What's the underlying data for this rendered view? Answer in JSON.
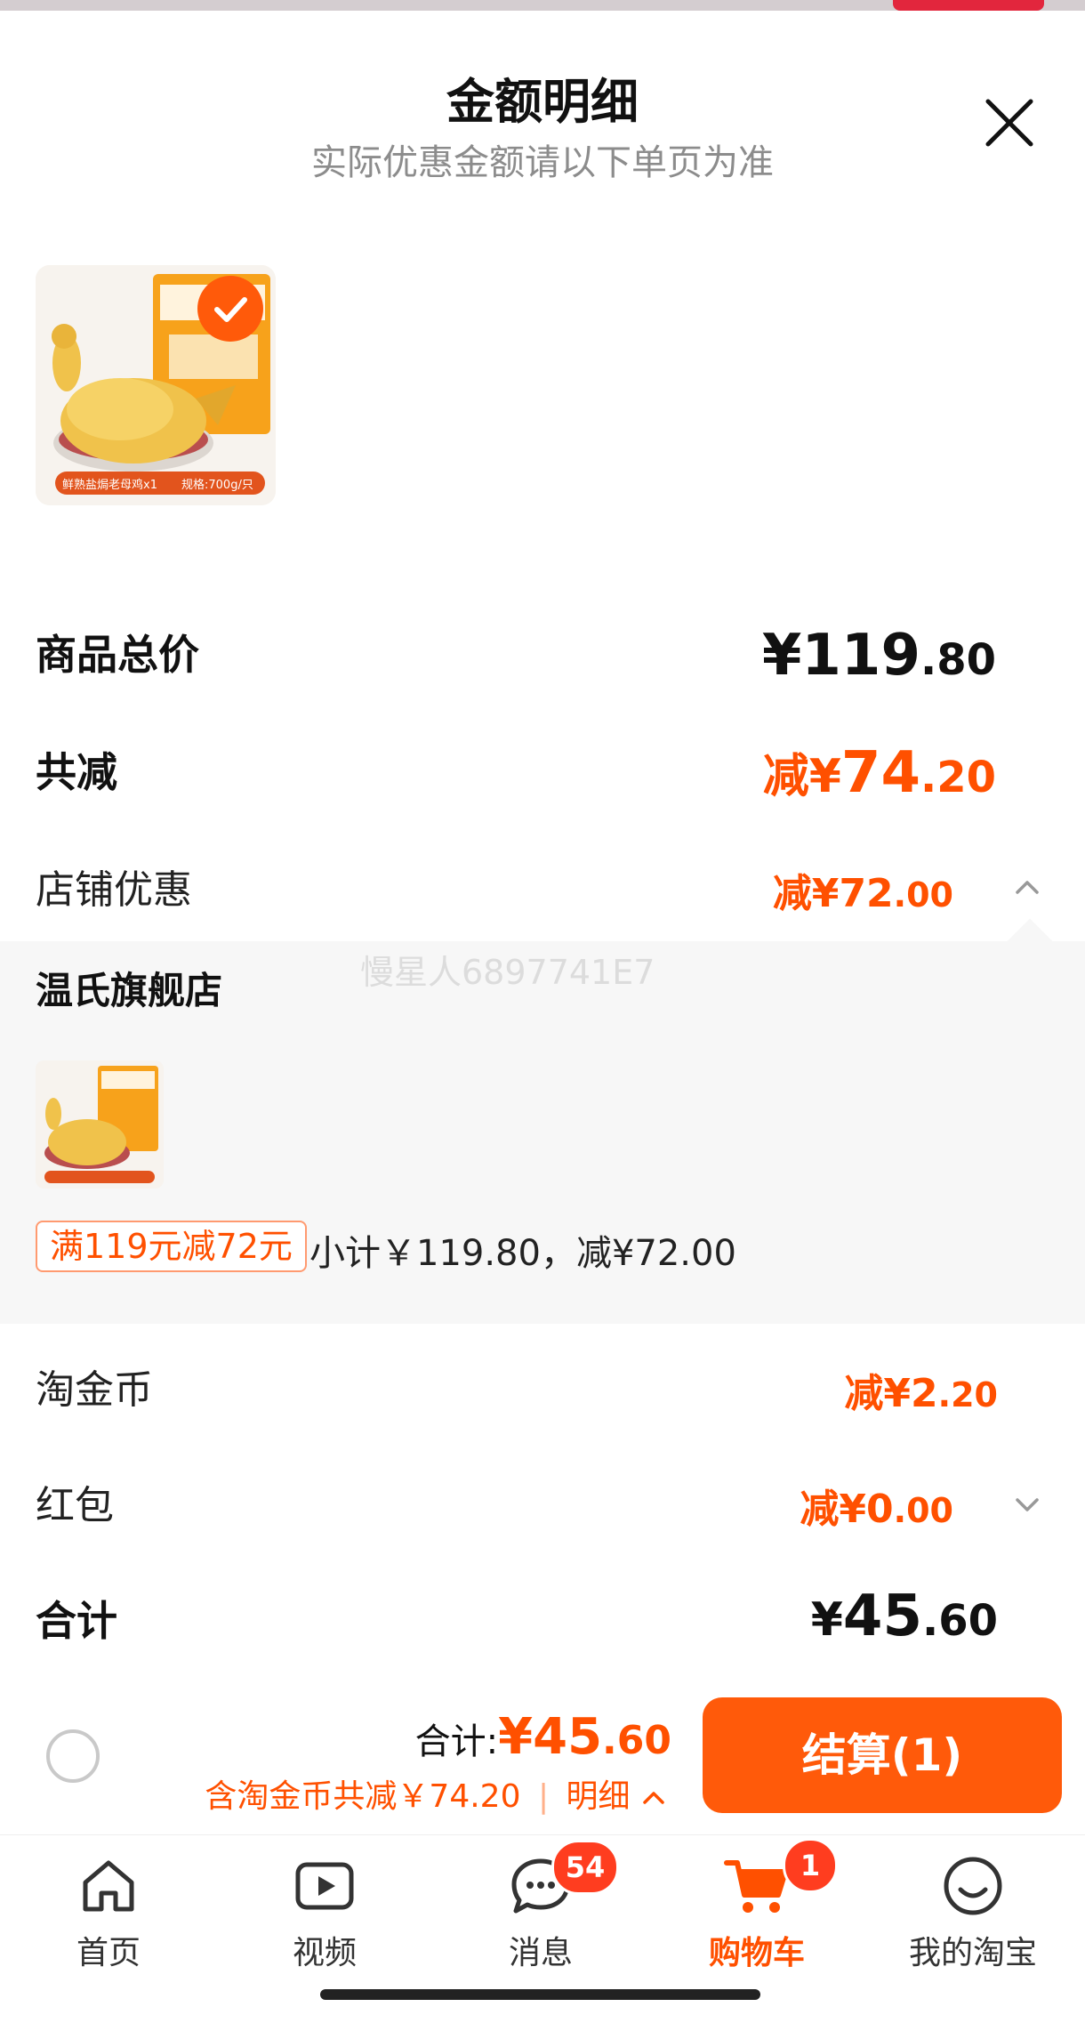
{
  "dialog": {
    "title": "金额明细",
    "subtitle": "实际优惠金额请以下单页为准"
  },
  "summary": {
    "goods_total_label": "商品总价",
    "goods_total_currency": "¥",
    "goods_total_int": "119",
    "goods_total_dec": ".80",
    "total_discount_label": "共减",
    "total_discount_prefix": "减¥",
    "total_discount_int": "74",
    "total_discount_dec": ".20",
    "store_discount_label": "店铺优惠",
    "store_discount_prefix": "减¥",
    "store_discount_int": "72",
    "store_discount_dec": ".00"
  },
  "store_panel": {
    "store_name": "温氏旗舰店",
    "watermark": "慢星人6897741E7",
    "promo_tag": "满119元减72元",
    "subtotal_text": "小计￥119.80，减¥72.00"
  },
  "coins": {
    "label": "淘金币",
    "prefix": "减¥",
    "int": "2",
    "dec": ".20"
  },
  "redpacket": {
    "label": "红包",
    "prefix": "减¥",
    "int": "0",
    "dec": ".00"
  },
  "total": {
    "label": "合计",
    "currency": "¥",
    "int": "45",
    "dec": ".60"
  },
  "bottom_bar": {
    "total_label": "合计:",
    "total_amount_int": "¥45",
    "total_amount_dec": ".60",
    "note": "含淘金币共减￥74.20",
    "detail_link": "明细",
    "checkout_label": "结算(1)"
  },
  "product": {
    "pack_label": "鲜熟盐焗老母鸡x1",
    "spec": "规格:700g/只"
  },
  "tabbar": {
    "items": [
      {
        "label": "首页",
        "icon": "home-icon"
      },
      {
        "label": "视频",
        "icon": "video-icon"
      },
      {
        "label": "消息",
        "icon": "message-icon",
        "badge": "54"
      },
      {
        "label": "购物车",
        "icon": "cart-icon",
        "badge": "1",
        "active": true
      },
      {
        "label": "我的淘宝",
        "icon": "profile-icon"
      }
    ]
  },
  "colors": {
    "accent": "#ff5000",
    "button": "#ff5a0a",
    "badge": "#ff3d1f"
  }
}
